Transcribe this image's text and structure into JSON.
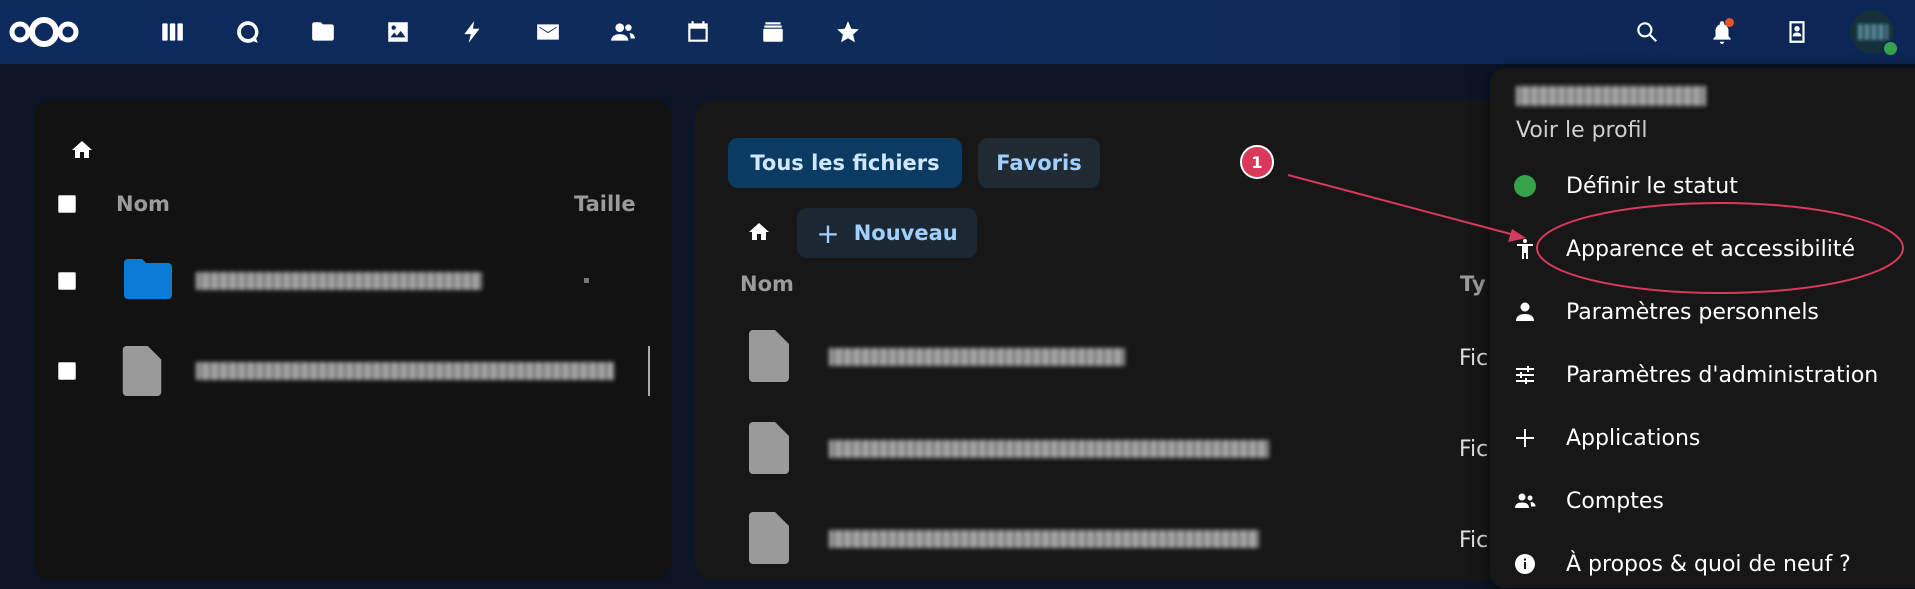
{
  "topbar": {
    "apps": [
      {
        "name": "dashboard-icon"
      },
      {
        "name": "talk-icon"
      },
      {
        "name": "files-icon"
      },
      {
        "name": "photos-icon"
      },
      {
        "name": "activity-icon"
      },
      {
        "name": "mail-icon"
      },
      {
        "name": "contacts-icon"
      },
      {
        "name": "calendar-icon"
      },
      {
        "name": "deck-icon"
      },
      {
        "name": "favorites-icon"
      }
    ],
    "right": [
      "search-icon",
      "notifications-icon",
      "contacts-menu-icon",
      "avatar"
    ],
    "colors": {
      "bar": "#0d2a5c",
      "notification_dot": "#e9522c",
      "online": "#36a24a"
    }
  },
  "left_panel": {
    "columns": {
      "name": "Nom",
      "size": "Taille"
    },
    "rows": [
      {
        "type": "folder"
      },
      {
        "type": "file"
      }
    ]
  },
  "main_panel": {
    "filters": {
      "all_files": "Tous les fichiers",
      "favorites": "Favoris"
    },
    "new_button": "Nouveau",
    "new_button_icon": "+",
    "columns": {
      "name": "Nom",
      "type": "Ty"
    },
    "rows": [
      {
        "type": "Fic"
      },
      {
        "type": "Fic"
      },
      {
        "type": "Fic"
      }
    ]
  },
  "user_menu": {
    "view_profile": "Voir le profil",
    "items": [
      {
        "label": "Définir le statut",
        "icon": "status-dot"
      },
      {
        "label": "Apparence et accessibilité",
        "icon": "accessibility-icon"
      },
      {
        "label": "Paramètres personnels",
        "icon": "person-icon"
      },
      {
        "label": "Paramètres d'administration",
        "icon": "sliders-icon"
      },
      {
        "label": "Applications",
        "icon": "plus-icon"
      },
      {
        "label": "Comptes",
        "icon": "accounts-icon"
      },
      {
        "label": "À propos & quoi de neuf ?",
        "icon": "info-icon"
      }
    ]
  },
  "annotation": {
    "badge": "1",
    "color": "#d9395b"
  }
}
